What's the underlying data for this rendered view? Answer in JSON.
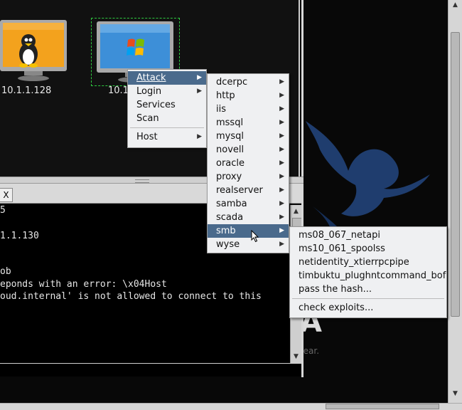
{
  "targets": [
    {
      "label": "10.1.1.128",
      "os": "linux"
    },
    {
      "label": "10.1.1.130",
      "os": "windows"
    }
  ],
  "tab": {
    "close_label": "X"
  },
  "console": {
    "lines": [
      "",
      "1.1.130",
      "",
      "ob",
      "eponds with an error: \\x04Host",
      "oud.internal' is not allowed to connect to this"
    ],
    "partial_top": "5"
  },
  "wallpaper_text": "e to hear.",
  "host_menu": {
    "items": [
      {
        "label": "Attack",
        "mnemonic_index": 0,
        "has_submenu": true,
        "selected": true
      },
      {
        "label": "Login",
        "mnemonic_index": 0,
        "has_submenu": true
      },
      {
        "label": "Services",
        "mnemonic_index": 1,
        "has_submenu": false
      },
      {
        "label": "Scan",
        "mnemonic_index": 1,
        "has_submenu": false
      },
      {
        "label": "Host",
        "mnemonic_index": 0,
        "has_submenu": true,
        "separator_before": true
      }
    ]
  },
  "attack_menu": {
    "items": [
      "dcerpc",
      "http",
      "iis",
      "mssql",
      "mysql",
      "novell",
      "oracle",
      "proxy",
      "realserver",
      "samba",
      "scada",
      "smb",
      "wyse"
    ],
    "selected": "smb"
  },
  "smb_menu": {
    "items": [
      "ms08_067_netapi",
      "ms10_061_spoolss",
      "netidentity_xtierrpcpipe",
      "timbuktu_plughntcommand_bof",
      "pass the hash...",
      "check exploits..."
    ]
  },
  "colors": {
    "menu_highlight": "#4a6a8c",
    "menu_background": "#eff0f2",
    "console_background": "#000000",
    "monitor_linux": "#f0a020",
    "monitor_windows": "#3d8fd8"
  }
}
